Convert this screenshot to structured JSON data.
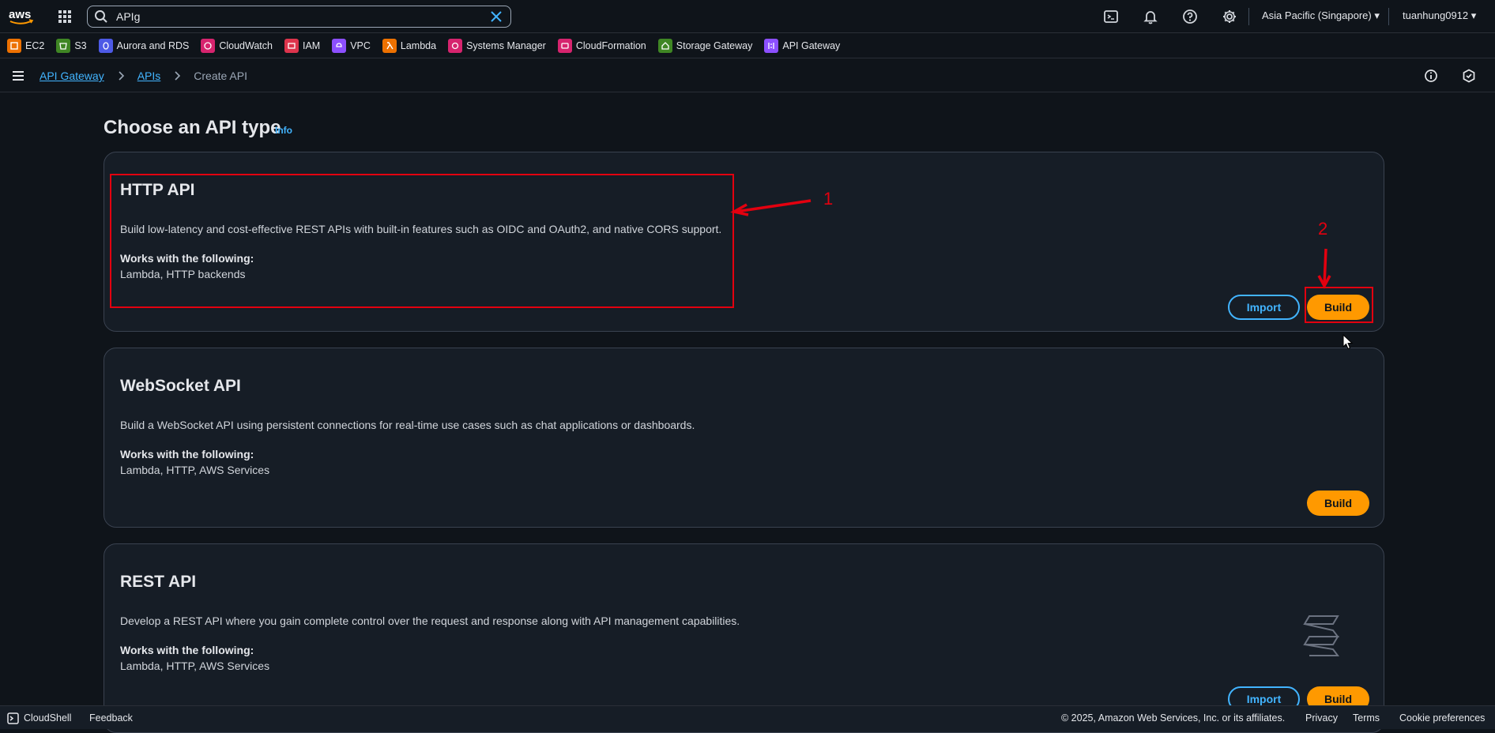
{
  "topnav": {
    "search_value": "APIg",
    "region": "Asia Pacific (Singapore) ▾",
    "user": "tuanhung0912 ▾"
  },
  "favorites": [
    {
      "label": "EC2",
      "color": "#ed7100",
      "icon": "ec2-icon"
    },
    {
      "label": "S3",
      "color": "#3f8624",
      "icon": "s3-icon"
    },
    {
      "label": "Aurora and RDS",
      "color": "#4d5ae6",
      "icon": "rds-icon"
    },
    {
      "label": "CloudWatch",
      "color": "#d6246e",
      "icon": "cloudwatch-icon"
    },
    {
      "label": "IAM",
      "color": "#dd344c",
      "icon": "iam-icon"
    },
    {
      "label": "VPC",
      "color": "#8c4fff",
      "icon": "vpc-icon"
    },
    {
      "label": "Lambda",
      "color": "#ed7100",
      "icon": "lambda-icon"
    },
    {
      "label": "Systems Manager",
      "color": "#d6246e",
      "icon": "systems-manager-icon"
    },
    {
      "label": "CloudFormation",
      "color": "#d6246e",
      "icon": "cloudformation-icon"
    },
    {
      "label": "Storage Gateway",
      "color": "#3f8624",
      "icon": "storage-gateway-icon"
    },
    {
      "label": "API Gateway",
      "color": "#8c4fff",
      "icon": "api-gateway-icon"
    }
  ],
  "breadcrumb": {
    "items": [
      "API Gateway",
      "APIs"
    ],
    "current": "Create API"
  },
  "page": {
    "title": "Choose an API type",
    "info": "Info"
  },
  "cards": {
    "http": {
      "title": "HTTP API",
      "description": "Build low-latency and cost-effective REST APIs with built-in features such as OIDC and OAuth2, and native CORS support.",
      "works_label": "Works with the following:",
      "works_value": "Lambda, HTTP backends",
      "import_label": "Import",
      "build_label": "Build"
    },
    "websocket": {
      "title": "WebSocket API",
      "description": "Build a WebSocket API using persistent connections for real-time use cases such as chat applications or dashboards.",
      "works_label": "Works with the following:",
      "works_value": "Lambda, HTTP, AWS Services",
      "build_label": "Build"
    },
    "rest": {
      "title": "REST API",
      "description": "Develop a REST API where you gain complete control over the request and response along with API management capabilities.",
      "works_label": "Works with the following:",
      "works_value": "Lambda, HTTP, AWS Services",
      "import_label": "Import",
      "build_label": "Build"
    }
  },
  "annotations": {
    "one": "1",
    "two": "2"
  },
  "footer": {
    "cloudshell": "CloudShell",
    "feedback": "Feedback",
    "copyright": "© 2025, Amazon Web Services, Inc. or its affiliates.",
    "privacy": "Privacy",
    "terms": "Terms",
    "cookies": "Cookie preferences"
  },
  "colors": {
    "accent_orange": "#ff9900",
    "link_blue": "#42b4ff",
    "annotation_red": "#e3000f"
  }
}
